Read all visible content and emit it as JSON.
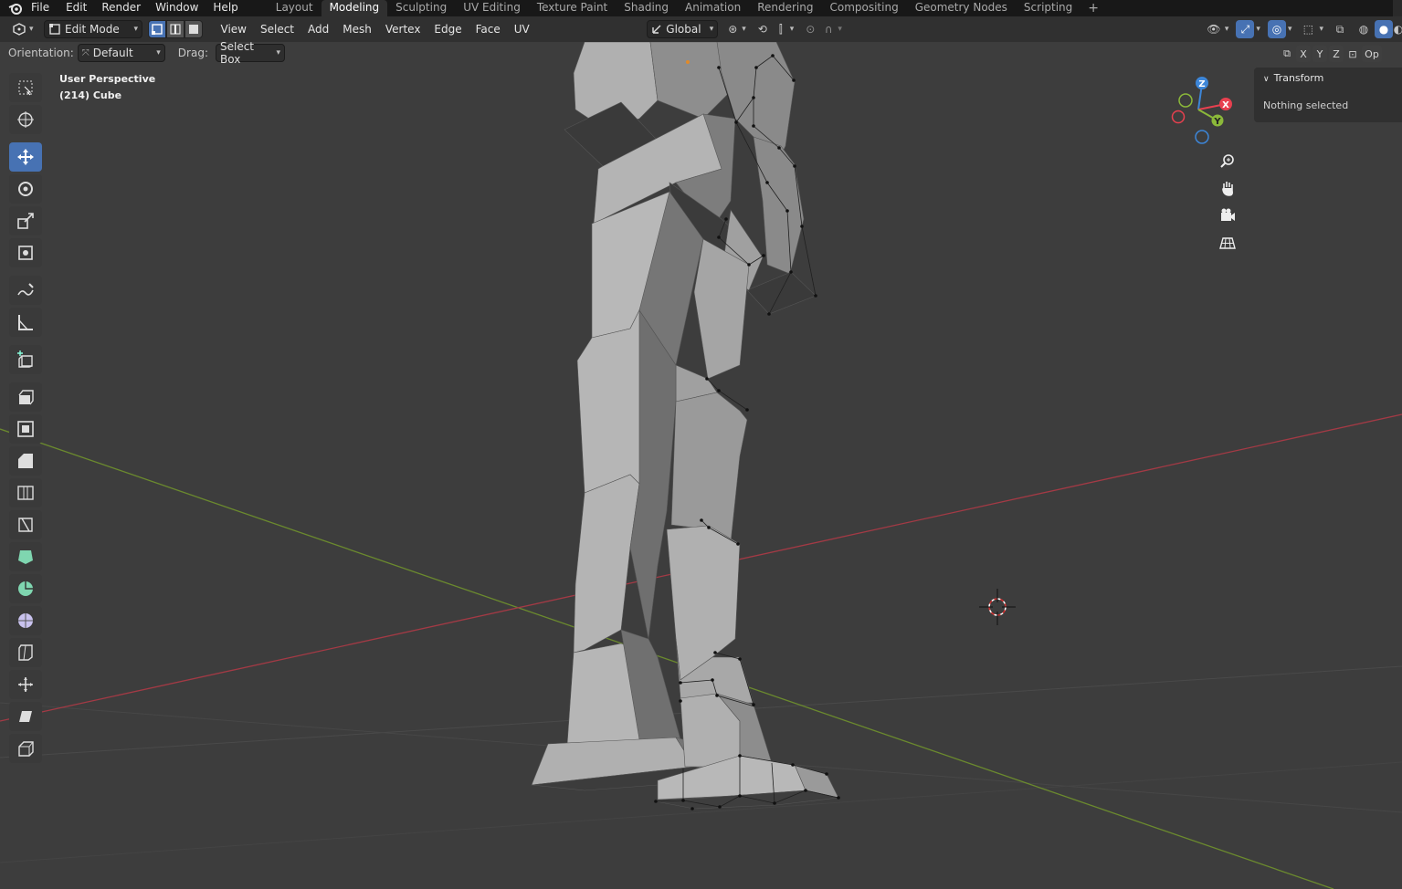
{
  "topbar": {
    "menus": [
      "File",
      "Edit",
      "Render",
      "Window",
      "Help"
    ],
    "workspaces": [
      "Layout",
      "Modeling",
      "Sculpting",
      "UV Editing",
      "Texture Paint",
      "Shading",
      "Animation",
      "Rendering",
      "Compositing",
      "Geometry Nodes",
      "Scripting"
    ],
    "active_workspace": "Modeling",
    "add_label": "+"
  },
  "header": {
    "mode": "Edit Mode",
    "menus": [
      "View",
      "Select",
      "Add",
      "Mesh",
      "Vertex",
      "Edge",
      "Face",
      "UV"
    ],
    "transform_orientation": "Global"
  },
  "toolheader": {
    "orientation_label": "Orientation:",
    "orientation_value": "Default",
    "drag_label": "Drag:",
    "drag_value": "Select Box",
    "axes": [
      "X",
      "Y",
      "Z"
    ],
    "options_label": "Op"
  },
  "viewport": {
    "perspective": "User Perspective",
    "object": "(214) Cube"
  },
  "gizmo": {
    "x": "X",
    "y": "Y",
    "z": "Z"
  },
  "npanel": {
    "title": "Transform",
    "content": "Nothing selected"
  },
  "colors": {
    "accent": "#4772b3",
    "axis_x": "#e8404f",
    "axis_y": "#8bb83a",
    "axis_z": "#3d86d8",
    "background": "#3d3d3d"
  }
}
